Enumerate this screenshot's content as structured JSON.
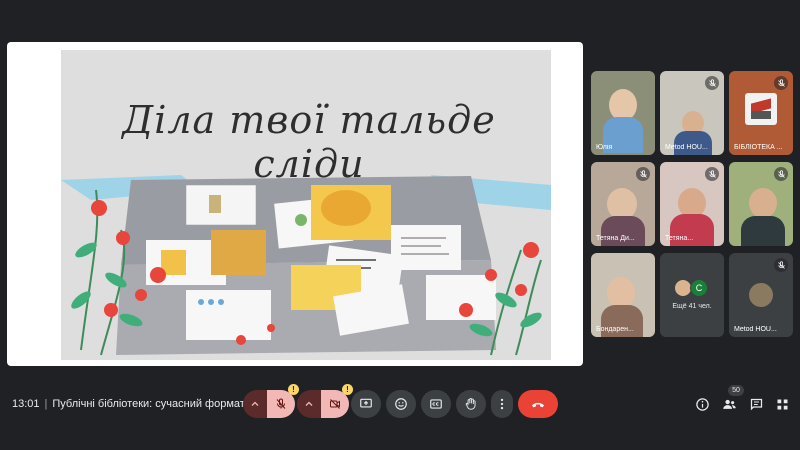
{
  "meeting": {
    "time": "13:01",
    "separator": "|",
    "title": "Публічні бібліотеки: сучасний формат"
  },
  "slide": {
    "title": "Діла твої тальде сліди"
  },
  "participants": [
    {
      "name": "Юлія",
      "muted": false
    },
    {
      "name": "Metod HOU...",
      "muted": true
    },
    {
      "name": "БІБЛІОТЕКА ...",
      "muted": true
    },
    {
      "name": "Тетяна Ди...",
      "muted": true
    },
    {
      "name": "Тетяна...",
      "muted": true
    },
    {
      "name": "",
      "muted": true
    },
    {
      "name": "Бондарен...",
      "muted": true
    },
    {
      "name": "Ещё 41 чел.",
      "muted": false
    },
    {
      "name": "Metod HOU...",
      "muted": true
    }
  ],
  "more": {
    "avatar_letter": "C",
    "label": "Ещё 41 чел."
  },
  "controls": {
    "mic": {
      "state": "off",
      "warning": "!"
    },
    "camera": {
      "state": "off",
      "warning": "!"
    },
    "present_icon": "present-screen-icon",
    "reactions_icon": "emoji-icon",
    "captions_icon": "captions-icon",
    "raise_hand_icon": "hand-icon",
    "more_icon": "more-vert-icon",
    "end_icon": "end-call-icon"
  },
  "right_panel": {
    "participant_count": "50"
  },
  "colors": {
    "background": "#202124",
    "muted_red": "#f2b8b5",
    "end_call": "#ea4335",
    "warning": "#fdd663"
  }
}
